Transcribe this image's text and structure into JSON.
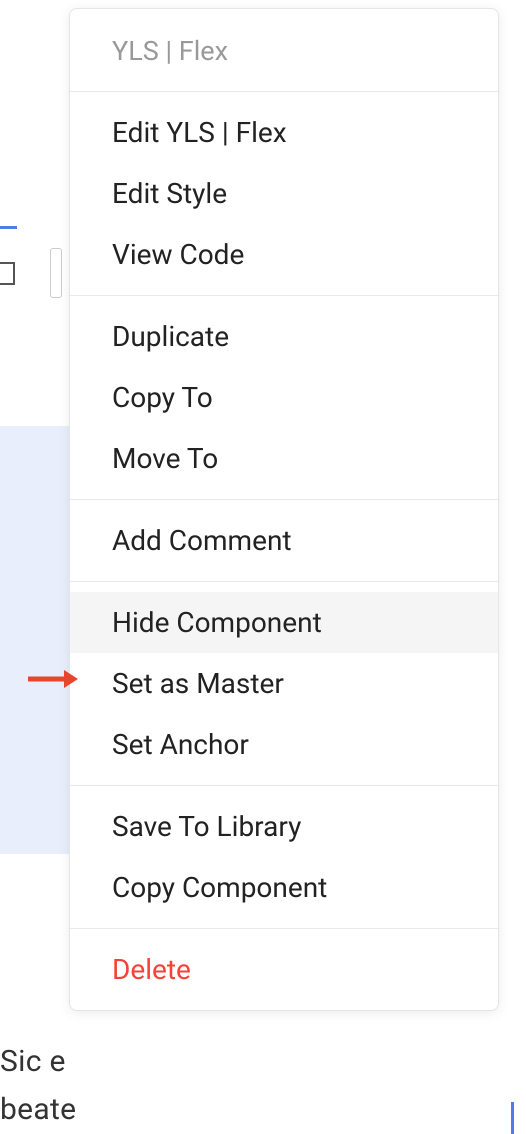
{
  "background": {
    "text_fragment_1": "Sic e",
    "text_fragment_2": "beate"
  },
  "menu": {
    "title": "YLS | Flex",
    "groups": [
      {
        "items": [
          {
            "id": "edit-component",
            "label": "Edit YLS | Flex"
          },
          {
            "id": "edit-style",
            "label": "Edit Style"
          },
          {
            "id": "view-code",
            "label": "View Code"
          }
        ]
      },
      {
        "items": [
          {
            "id": "duplicate",
            "label": "Duplicate"
          },
          {
            "id": "copy-to",
            "label": "Copy To"
          },
          {
            "id": "move-to",
            "label": "Move To"
          }
        ]
      },
      {
        "items": [
          {
            "id": "add-comment",
            "label": "Add Comment"
          }
        ]
      },
      {
        "items": [
          {
            "id": "hide-component",
            "label": "Hide Component",
            "highlighted": true
          },
          {
            "id": "set-as-master",
            "label": "Set as Master"
          },
          {
            "id": "set-anchor",
            "label": "Set Anchor"
          }
        ]
      },
      {
        "items": [
          {
            "id": "save-to-library",
            "label": "Save To Library"
          },
          {
            "id": "copy-component",
            "label": "Copy Component"
          }
        ]
      },
      {
        "items": [
          {
            "id": "delete",
            "label": "Delete",
            "danger": true
          }
        ]
      }
    ]
  },
  "annotation": {
    "arrow_color": "#e8452f"
  }
}
